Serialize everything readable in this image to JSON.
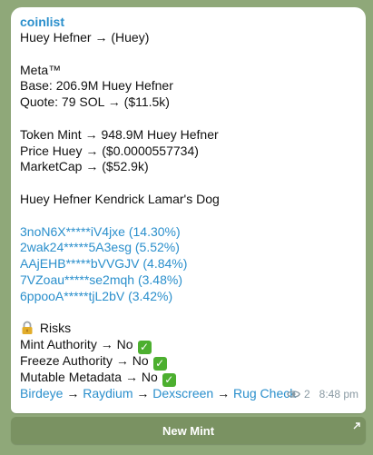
{
  "message": {
    "sender": "coinlist",
    "title_line": "Huey Hefner → (Huey)",
    "meta_label": "Meta™",
    "base_line": "Base: 206.9M Huey Hefner",
    "quote_line": "Quote: 79 SOL → ($11.5k)",
    "token_mint_line": "Token Mint → 948.9M Huey Hefner",
    "price_line": "Price Huey → ($0.0000557734)",
    "marketcap_line": "MarketCap → ($52.9k)",
    "description": "Huey Hefner Kendrick Lamar's Dog",
    "holders": [
      "3noN6X*****iV4jxe (14.30%)",
      "2wak24*****5A3esg (5.52%)",
      "AAjEHB*****bVVGJV (4.84%)",
      "7VZoau*****se2mqh (3.48%)",
      "6ppooA*****tjL2bV (3.42%)"
    ],
    "risks_label": "Risks",
    "risk_lines": [
      "Mint Authority → No",
      "Freeze Authority → No",
      "Mutable Metadata → No"
    ],
    "links": {
      "birdeye": "Birdeye",
      "raydium": "Raydium",
      "dexscreen": "Dexscreen",
      "rug_check": "Rug Check",
      "separator": "→"
    },
    "views": "2",
    "time": "8:48 pm"
  },
  "button": {
    "label": "New Mint"
  },
  "colors": {
    "background": "#8fa879",
    "bubble": "#ffffff",
    "link": "#2a8fcc",
    "button": "#7a9262",
    "check": "#4caf2f"
  },
  "icons": {
    "lock": "lock-icon",
    "check": "check-mark-icon",
    "views": "eye-icon",
    "button_arrow": "external-arrow-icon"
  }
}
